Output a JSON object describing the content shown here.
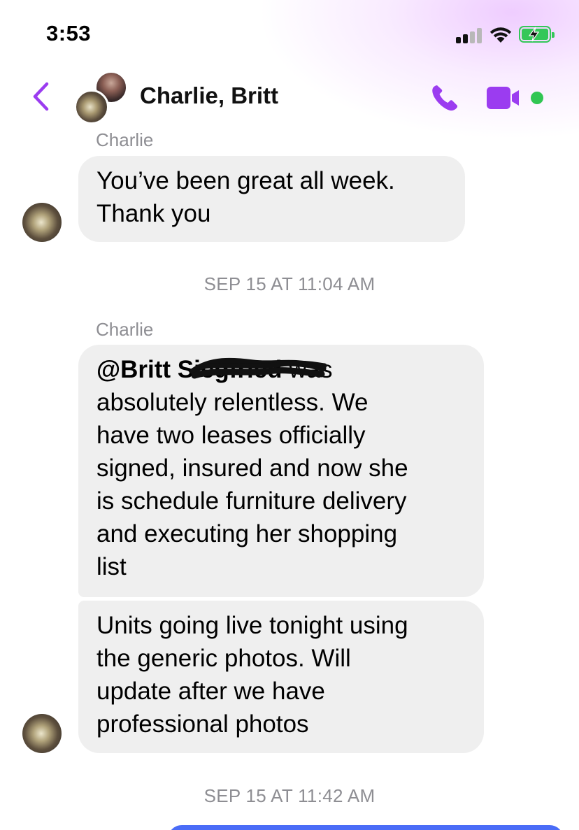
{
  "status_bar": {
    "time": "3:53"
  },
  "header": {
    "title": "Charlie, Britt"
  },
  "messages": {
    "m1": {
      "sender": "Charlie",
      "line1": "You’ve been great all week.",
      "line2": "Thank you"
    },
    "ts1": "SEP 15 AT 11:04 AM",
    "m2": {
      "sender": "Charlie",
      "mention": "@Britt Siegfried",
      "line1_rest": " was",
      "line2": "absolutely relentless. We",
      "line3": "have two leases officially",
      "line4": "signed, insured and now she",
      "line5": "is schedule furniture delivery",
      "line6": "and executing her shopping",
      "line7": "list"
    },
    "m3": {
      "line1": "Units going live tonight using",
      "line2": "the generic photos. Will",
      "line3": "update after we have",
      "line4": "professional photos"
    },
    "ts2": "SEP 15 AT 11:42 AM"
  },
  "colors": {
    "accent": "#9b3cf0",
    "bubble": "#efefef",
    "active": "#31c653",
    "meta_text": "#8e8e93"
  },
  "icons": {
    "back": "chevron-left-icon",
    "call": "phone-icon",
    "video": "video-camera-icon"
  }
}
